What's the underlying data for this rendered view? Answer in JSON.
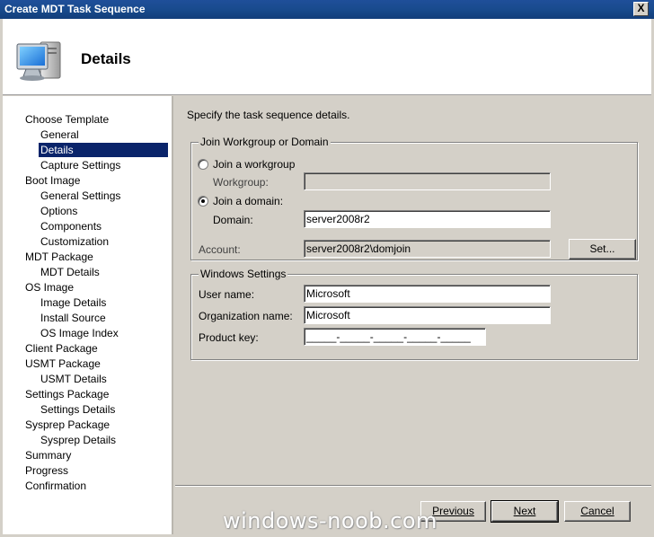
{
  "window": {
    "title": "Create MDT Task Sequence",
    "close_label": "X"
  },
  "header": {
    "title": "Details",
    "icon": "computer-icon"
  },
  "nav": {
    "items": [
      {
        "label": "Choose Template",
        "level": 0
      },
      {
        "label": "General",
        "level": 1
      },
      {
        "label": "Details",
        "level": 1,
        "selected": true
      },
      {
        "label": "Capture Settings",
        "level": 1
      },
      {
        "label": "Boot Image",
        "level": 0
      },
      {
        "label": "General Settings",
        "level": 1
      },
      {
        "label": "Options",
        "level": 1
      },
      {
        "label": "Components",
        "level": 1
      },
      {
        "label": "Customization",
        "level": 1
      },
      {
        "label": "MDT Package",
        "level": 0
      },
      {
        "label": "MDT Details",
        "level": 1
      },
      {
        "label": "OS Image",
        "level": 0
      },
      {
        "label": "Image Details",
        "level": 1
      },
      {
        "label": "Install Source",
        "level": 1
      },
      {
        "label": "OS Image Index",
        "level": 1
      },
      {
        "label": "Client Package",
        "level": 0
      },
      {
        "label": "USMT Package",
        "level": 0
      },
      {
        "label": "USMT Details",
        "level": 1
      },
      {
        "label": "Settings Package",
        "level": 0
      },
      {
        "label": "Settings Details",
        "level": 1
      },
      {
        "label": "Sysprep Package",
        "level": 0
      },
      {
        "label": "Sysprep Details",
        "level": 1
      },
      {
        "label": "Summary",
        "level": 0
      },
      {
        "label": "Progress",
        "level": 0
      },
      {
        "label": "Confirmation",
        "level": 0
      }
    ]
  },
  "content": {
    "instruction": "Specify the task sequence details.",
    "join_group": {
      "title": "Join Workgroup or Domain",
      "workgroup_radio": "Join a workgroup",
      "workgroup_label": "Workgroup:",
      "workgroup_value": "",
      "domain_radio": "Join a domain:",
      "domain_label": "Domain:",
      "domain_value": "server2008r2",
      "account_label": "Account:",
      "account_value": "server2008r2\\domjoin",
      "set_button": "Set..."
    },
    "windows_settings": {
      "title": "Windows Settings",
      "user_name_label": "User name:",
      "user_name_value": "Microsoft",
      "org_name_label": "Organization name:",
      "org_name_value": "Microsoft",
      "product_key_label": "Product key:",
      "product_key_value": "_____-_____-_____-_____-_____"
    }
  },
  "footer": {
    "previous": "Previous",
    "next": "Next",
    "cancel": "Cancel"
  },
  "watermark": "windows-noob.com"
}
